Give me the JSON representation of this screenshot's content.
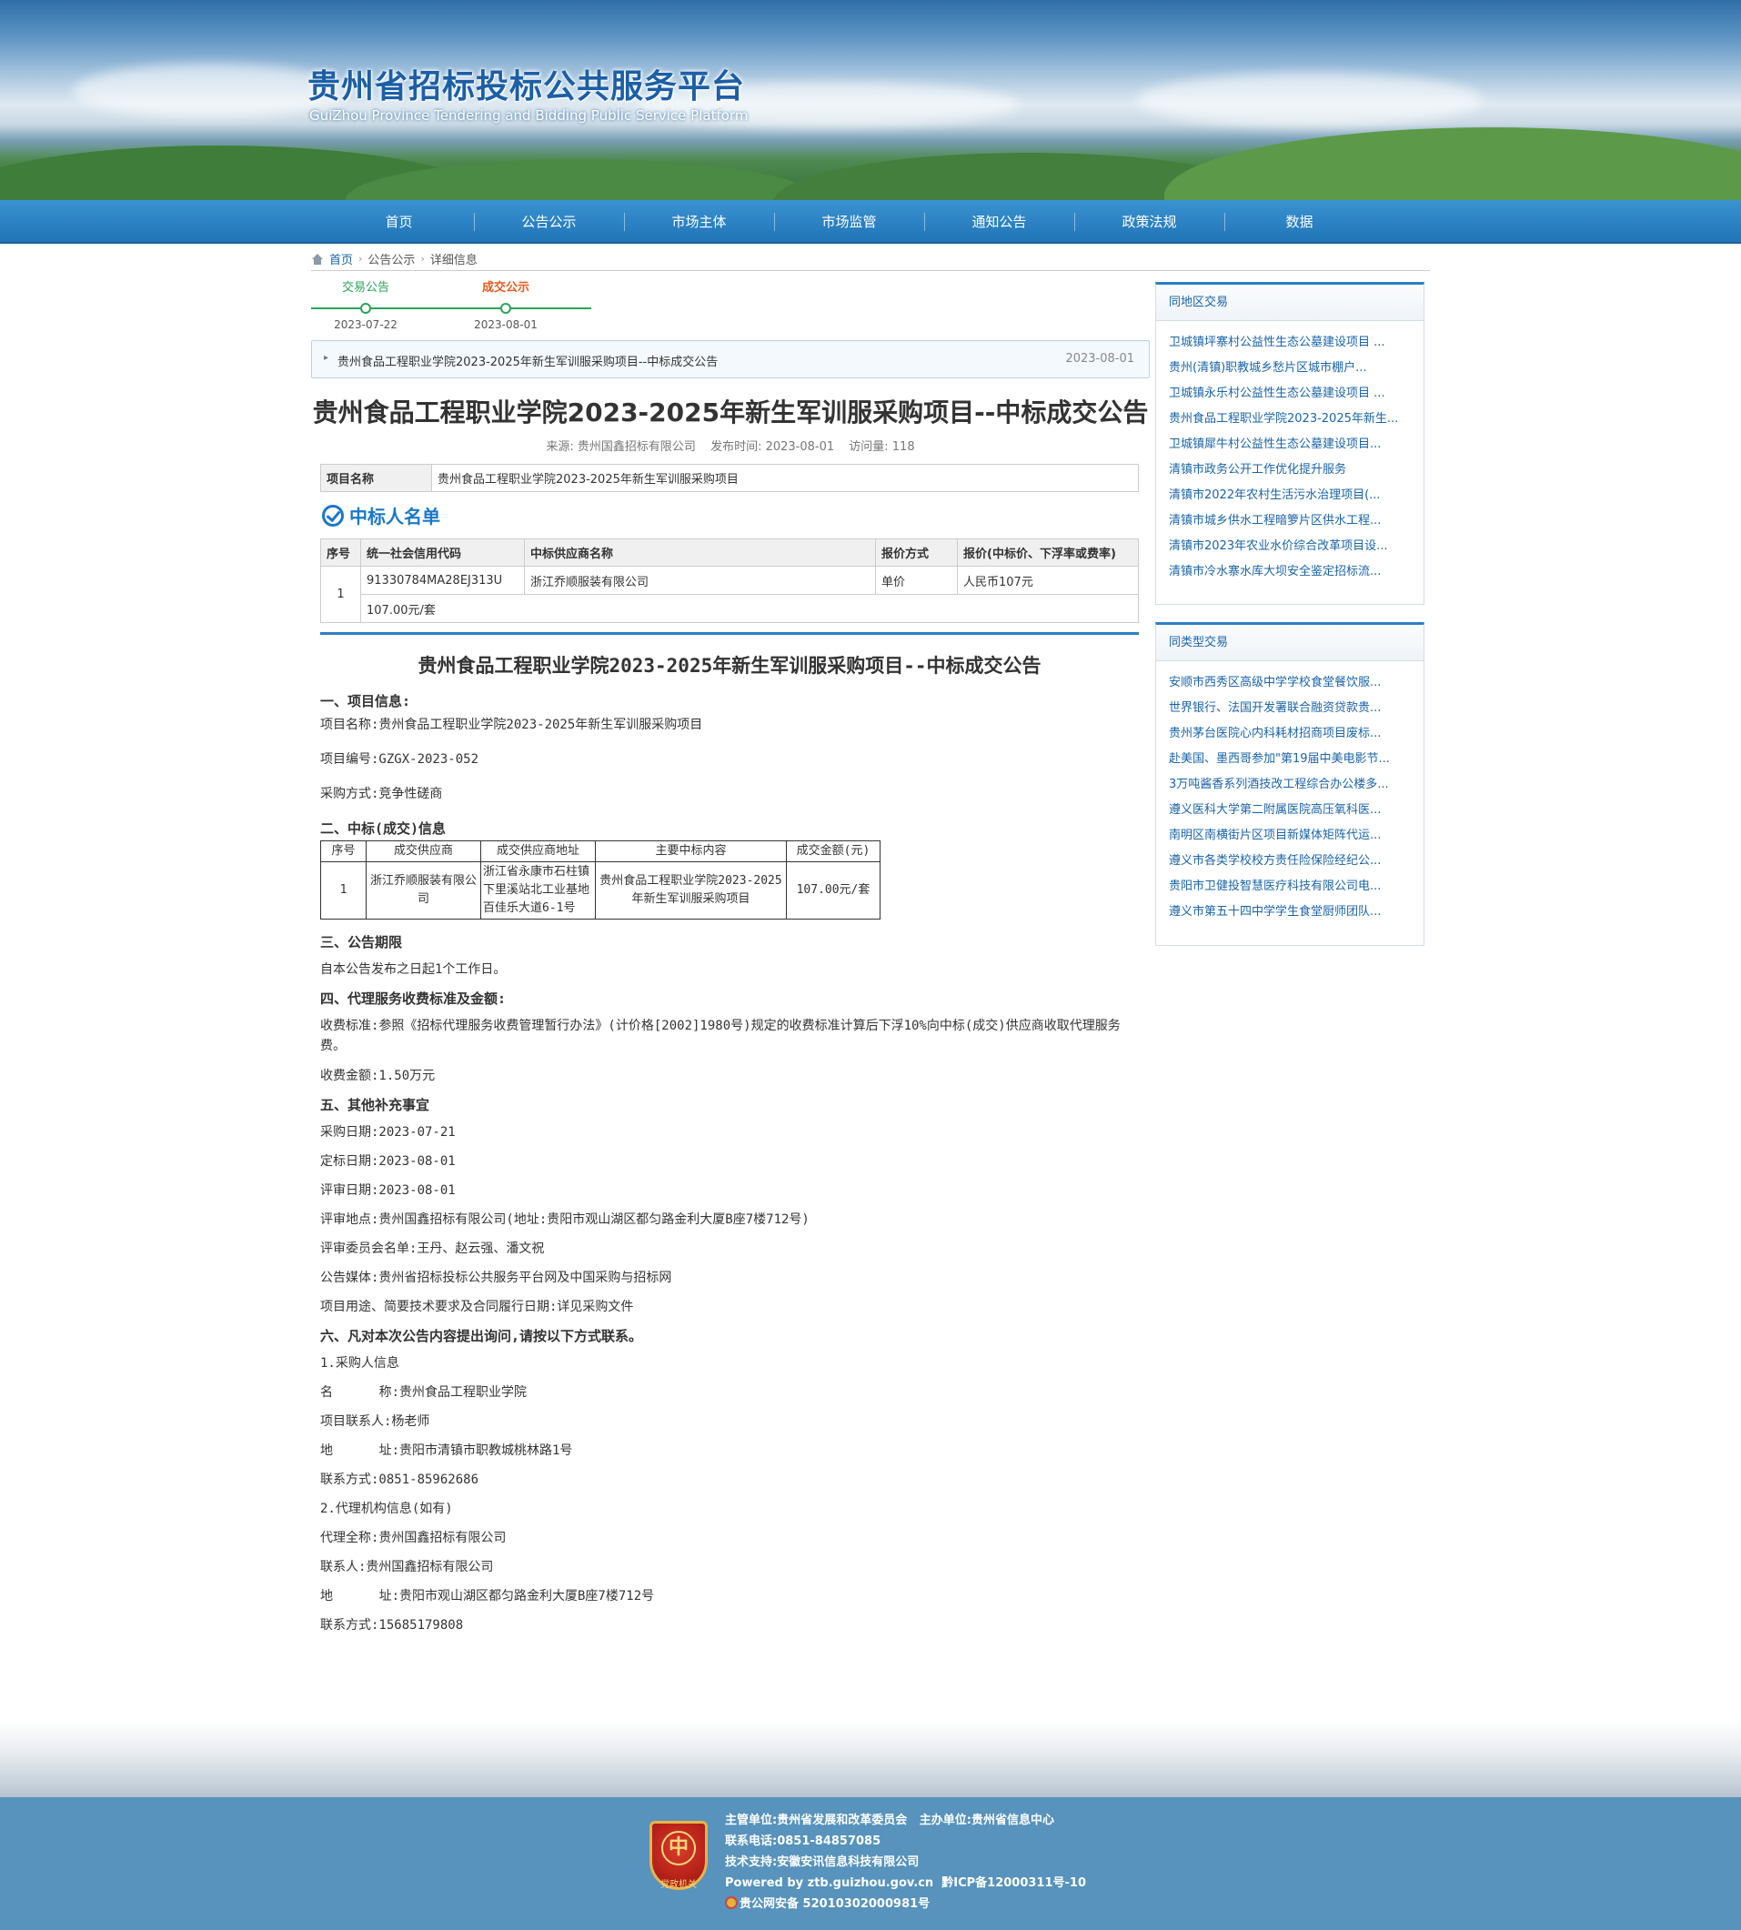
{
  "header": {
    "title_cn": "贵州省招标投标公共服务平台",
    "title_en": "GuiZhou Province Tendering and Bidding Public Service Platform"
  },
  "nav": [
    "首页",
    "公告公示",
    "市场主体",
    "市场监管",
    "通知公告",
    "政策法规",
    "数据"
  ],
  "breadcrumb": {
    "home": "首页",
    "section": "公告公示",
    "current": "详细信息"
  },
  "timeline": [
    {
      "label": "交易公告",
      "date": "2023-07-22",
      "color": "#2aa35a"
    },
    {
      "label": "成交公示",
      "date": "2023-08-01",
      "color": "#e85a1c"
    }
  ],
  "notice": {
    "text": "贵州食品工程职业学院2023-2025年新生军训服采购项目--中标成交公告",
    "date": "2023-08-01"
  },
  "article": {
    "title": "贵州食品工程职业学院2023-2025年新生军训服采购项目--中标成交公告",
    "source": "来源: 贵州国鑫招标有限公司",
    "published": "发布时间: 2023-08-01",
    "views": "访问量: 118"
  },
  "project": {
    "key": "项目名称",
    "value": "贵州食品工程职业学院2023-2025年新生军训服采购项目"
  },
  "winners": {
    "heading": "中标人名单",
    "headers": [
      "序号",
      "统一社会信用代码",
      "中标供应商名称",
      "报价方式",
      "报价(中标价、下浮率或费率)"
    ],
    "row": {
      "no": "1",
      "code": "91330784MA28EJ313U",
      "name": "浙江乔顺服装有限公司",
      "method": "单价",
      "price": "人民币107元",
      "extra": "107.00元/套"
    }
  },
  "doc": {
    "title": "贵州食品工程职业学院2023-2025年新生军训服采购项目--中标成交公告",
    "h1": "一、项目信息:",
    "p_name": "项目名称:贵州食品工程职业学院2023-2025年新生军训服采购项目",
    "p_code": "项目编号:GZGX-2023-052",
    "p_method": "采购方式:竞争性磋商",
    "h2": "二、中标(成交)信息",
    "deal_headers": [
      "序号",
      "成交供应商",
      "成交供应商地址",
      "主要中标内容",
      "成交金额(元)"
    ],
    "deal_row": [
      "1",
      "浙江乔顺服装有限公司",
      "浙江省永康市石柱镇下里溪站北工业基地百佳乐大道6-1号",
      "贵州食品工程职业学院2023-2025年新生军训服采购项目",
      "107.00元/套"
    ],
    "h3": "三、公告期限",
    "p_period": "自本公告发布之日起1个工作日。",
    "h4": "四、代理服务收费标准及金额:",
    "p_fee_std": "收费标准:参照《招标代理服务收费管理暂行办法》(计价格[2002]1980号)规定的收费标准计算后下浮10%向中标(成交)供应商收取代理服务费。",
    "p_fee_amt": "收费金额:1.50万元",
    "h5": "五、其他补充事宜",
    "p_buy_date": "采购日期:2023-07-21",
    "p_fix_date": "定标日期:2023-08-01",
    "p_review_date": "评审日期:2023-08-01",
    "p_review_place": "评审地点:贵州国鑫招标有限公司(地址:贵阳市观山湖区都匀路金利大厦B座7楼712号)",
    "p_committee": "评审委员会名单:王丹、赵云强、潘文祝",
    "p_media": "公告媒体:贵州省招标投标公共服务平台网及中国采购与招标网",
    "p_usage": "项目用途、简要技术要求及合同履行日期:详见采购文件",
    "h6": "六、凡对本次公告内容提出询问,请按以下方式联系。",
    "p_buyer_h": "1.采购人信息",
    "p_buyer_name": "名      称:贵州食品工程职业学院",
    "p_buyer_contact": "项目联系人:杨老师",
    "p_buyer_addr": "地      址:贵阳市清镇市职教城桃林路1号",
    "p_buyer_tel": "联系方式:0851-85962686",
    "p_agent_h": "2.代理机构信息(如有)",
    "p_agent_name": "代理全称:贵州国鑫招标有限公司",
    "p_agent_contact": "联系人:贵州国鑫招标有限公司",
    "p_agent_addr": "地      址:贵阳市观山湖区都匀路金利大厦B座7楼712号",
    "p_agent_tel": "联系方式:15685179808"
  },
  "sidebar": {
    "region_title": "同地区交易",
    "region_items": [
      "卫城镇坪寨村公益性生态公墓建设项目 ...",
      "贵州(清镇)职教城乡愁片区城市棚户...",
      "卫城镇永乐村公益性生态公墓建设项目 ...",
      "贵州食品工程职业学院2023-2025年新生...",
      "卫城镇犀牛村公益性生态公墓建设项目...",
      "清镇市政务公开工作优化提升服务",
      "清镇市2022年农村生活污水治理项目(...",
      "清镇市城乡供水工程暗箩片区供水工程...",
      "清镇市2023年农业水价综合改革项目设...",
      "清镇市冷水寨水库大坝安全鉴定招标流..."
    ],
    "type_title": "同类型交易",
    "type_items": [
      "安顺市西秀区高级中学学校食堂餐饮服...",
      "世界银行、法国开发署联合融资贷款贵...",
      "贵州茅台医院心内科耗材招商项目废标...",
      "赴美国、墨西哥参加\"第19届中美电影节...",
      "3万吨酱香系列酒技改工程综合办公楼多...",
      "遵义医科大学第二附属医院高压氧科医...",
      "南明区南横街片区项目新媒体矩阵代运...",
      "遵义市各类学校校方责任险保险经纪公...",
      "贵阳市卫健投智慧医疗科技有限公司电...",
      "遵义市第五十四中学学生食堂厨师团队..."
    ]
  },
  "footer": {
    "emblem_text": "党政机关",
    "line1": "主管单位:贵州省发展和改革委员会   主办单位:贵州省信息中心",
    "line2": "联系电话:0851-84857085",
    "line3": "技术支持:安徽安讯信息科技有限公司",
    "line4": "Powered by ztb.guizhou.gov.cn  黔ICP备12000311号-10",
    "line5": "贵公网安备 52010302000981号"
  }
}
